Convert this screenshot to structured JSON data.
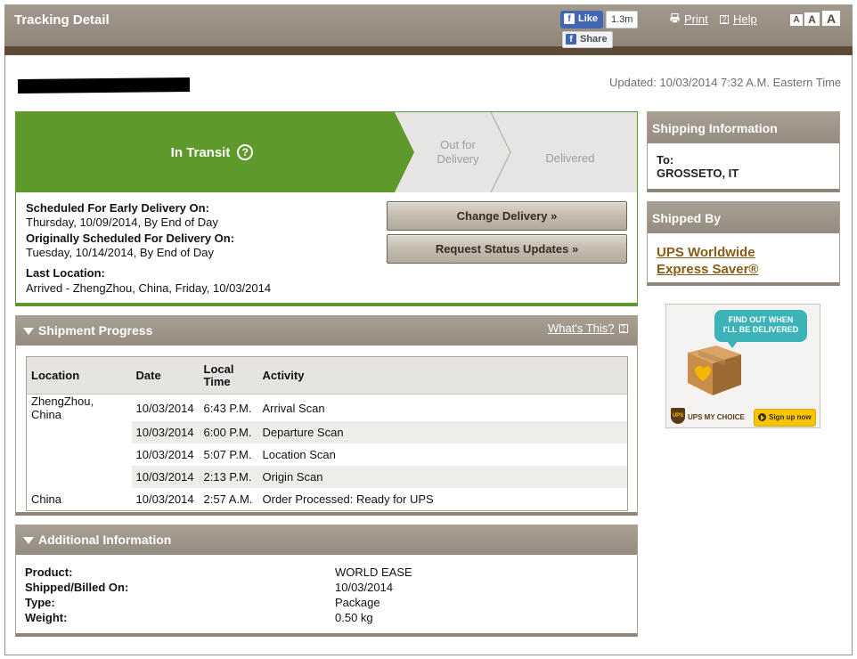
{
  "header": {
    "title": "Tracking Detail",
    "fb_like_label": "Like",
    "fb_like_count": "1.3m",
    "fb_share_label": "Share",
    "print_label": "Print",
    "help_label": "Help",
    "font_size_labels": [
      "A",
      "A",
      "A"
    ]
  },
  "updated": "Updated: 10/03/2014 7:32 A.M. Eastern Time",
  "status": {
    "steps": [
      {
        "label": "In Transit",
        "state": "active"
      },
      {
        "label_line1": "Out for",
        "label_line2": "Delivery",
        "state": "pending"
      },
      {
        "label": "Delivered",
        "state": "pending"
      }
    ],
    "help_icon": "?",
    "scheduled_early_label": "Scheduled For Early Delivery On:",
    "scheduled_early_value": "Thursday, 10/09/2014, By End of Day",
    "originally_scheduled_label": "Originally Scheduled For Delivery On:",
    "originally_scheduled_value": "Tuesday, 10/14/2014, By End of Day",
    "last_location_label": "Last Location:",
    "last_location_value": "Arrived - ZhengZhou, China, Friday, 10/03/2014",
    "change_delivery_label": "Change Delivery »",
    "request_updates_label": "Request Status Updates »"
  },
  "shipment_progress": {
    "title": "Shipment Progress",
    "whats_this_label": "What's This?",
    "columns": [
      "Location",
      "Date",
      "Local Time",
      "Activity"
    ],
    "rows": [
      {
        "location": "ZhengZhou, China",
        "date": "10/03/2014",
        "time": "6:43 P.M.",
        "activity": "Arrival Scan"
      },
      {
        "location": "",
        "date": "10/03/2014",
        "time": "6:00 P.M.",
        "activity": "Departure Scan"
      },
      {
        "location": "",
        "date": "10/03/2014",
        "time": "5:07 P.M.",
        "activity": "Location Scan"
      },
      {
        "location": "",
        "date": "10/03/2014",
        "time": "2:13 P.M.",
        "activity": "Origin Scan"
      },
      {
        "location": "China",
        "date": "10/03/2014",
        "time": "2:57 A.M.",
        "activity": "Order Processed: Ready for UPS"
      }
    ]
  },
  "additional_info": {
    "title": "Additional Information",
    "product_label": "Product:",
    "product_value": "WORLD EASE",
    "shipped_label": "Shipped/Billed On:",
    "shipped_value": "10/03/2014",
    "type_label": "Type:",
    "type_value": "Package",
    "weight_label": "Weight:",
    "weight_value": "0.50 kg"
  },
  "shipping_information": {
    "title": "Shipping Information",
    "to_label": "To:",
    "to_value": "GROSSETO, IT"
  },
  "shipped_by": {
    "title": "Shipped By",
    "carrier_line1": "UPS Worldwide",
    "carrier_line2": "Express Saver®"
  },
  "ad": {
    "bubble_line1": "FIND OUT WHEN",
    "bubble_line2": "I'LL BE DELIVERED",
    "logo_text": "UPS",
    "brand": "UPS MY CHOICE",
    "cta": "Sign up now"
  },
  "colors": {
    "header_brown": "#958b7e",
    "dark_brown": "#5c4a37",
    "active_green": "#5e9a2b",
    "link_brown": "#8a5a16"
  }
}
